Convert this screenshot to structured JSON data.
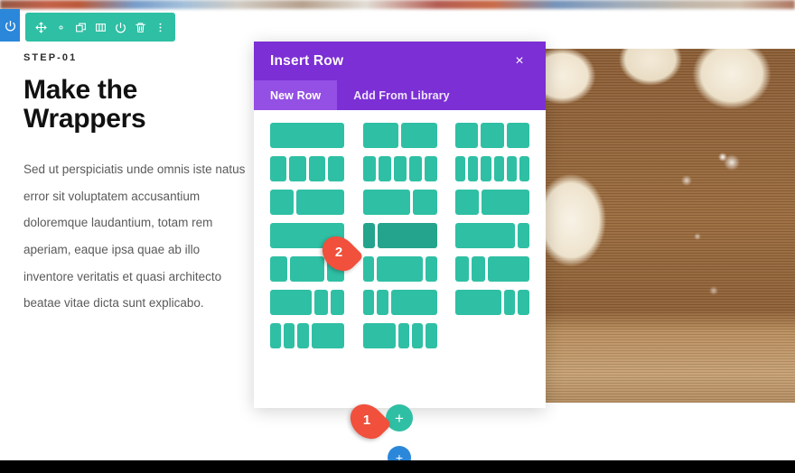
{
  "page": {
    "background_color": "#ffffff",
    "photo_strip_alt": "blurred photo band"
  },
  "element_toolbar": {
    "power_tab_icon": "power-icon",
    "buttons": [
      {
        "name": "move-handle",
        "icon": "move-arrows-icon",
        "title": "Move"
      },
      {
        "name": "settings-button",
        "icon": "gear-icon",
        "title": "Settings"
      },
      {
        "name": "duplicate-button",
        "icon": "duplicate-icon",
        "title": "Duplicate"
      },
      {
        "name": "columns-button",
        "icon": "columns-icon",
        "title": "Columns"
      },
      {
        "name": "disable-button",
        "icon": "power-icon",
        "title": "Disable"
      },
      {
        "name": "delete-button",
        "icon": "trash-icon",
        "title": "Delete"
      },
      {
        "name": "more-button",
        "icon": "ellipsis-vertical-icon",
        "title": "More Options"
      }
    ],
    "accent_color": "#2fbfa4",
    "power_tab_color": "#2b87da"
  },
  "content": {
    "eyebrow": "STEP-01",
    "headline": "Make the Wrappers",
    "paragraph": "Sed ut perspiciatis unde omnis iste natus error sit voluptatem accusantium doloremque laudantium, totam rem aperiam, eaque ipsa quae ab illo inventore veritatis et quasi architecto beatae vitae dicta sunt explicabo.",
    "image_alt": "Dough balls on a floured wooden cutting board"
  },
  "modal": {
    "title": "Insert Row",
    "close_label": "×",
    "header_color": "#7b2fd4",
    "active_tab_color": "#9450e4",
    "tabs": [
      {
        "label": "New Row",
        "active": true
      },
      {
        "label": "Add From Library",
        "active": false
      }
    ],
    "layout_color": "#2fbfa4",
    "layout_hover_color": "#24a48c",
    "layout_rows": [
      [
        {
          "name": "layout-1-1",
          "segments": [
            6
          ],
          "hover": false
        },
        {
          "name": "layout-1-2-1-2",
          "segments": [
            3,
            3
          ],
          "hover": false
        },
        {
          "name": "layout-1-3-1-3-1-3",
          "segments": [
            2,
            2,
            2
          ],
          "hover": false
        }
      ],
      [
        {
          "name": "layout-1-4-x4",
          "segments": [
            1,
            1,
            1,
            1
          ],
          "hover": false
        },
        {
          "name": "layout-1-5-x5",
          "segments": [
            1,
            1,
            1,
            1,
            1
          ],
          "hover": false
        },
        {
          "name": "layout-1-6-x6",
          "segments": [
            1,
            1,
            1,
            1,
            1,
            1
          ],
          "hover": false
        }
      ],
      [
        {
          "name": "layout-1-3-2-3",
          "segments": [
            2,
            4
          ],
          "hover": false
        },
        {
          "name": "layout-2-3-1-3",
          "segments": [
            4,
            2
          ],
          "hover": false
        },
        {
          "name": "layout-1-3-2-3-b",
          "segments": [
            2,
            4
          ],
          "hover": false
        }
      ],
      [
        {
          "name": "layout-1-1-b",
          "segments": [
            6
          ],
          "hover": false
        },
        {
          "name": "layout-1-5-4-5",
          "segments": [
            1,
            5
          ],
          "hover": true
        },
        {
          "name": "layout-4-5-1-5",
          "segments": [
            5,
            1
          ],
          "hover": false
        }
      ],
      [
        {
          "name": "layout-1-4-1-2-1-4",
          "segments": [
            1,
            2,
            1
          ],
          "hover": false
        },
        {
          "name": "layout-1-6-2-3-1-6",
          "segments": [
            1,
            4,
            1
          ],
          "hover": false
        },
        {
          "name": "layout-1-6-1-6-2-3",
          "segments": [
            1,
            1,
            3
          ],
          "hover": false
        }
      ],
      [
        {
          "name": "layout-1-2-1-4-1-4",
          "segments": [
            3,
            1,
            1
          ],
          "hover": false
        },
        {
          "name": "layout-1-6-1-6-2-3-b",
          "segments": [
            1,
            1,
            4
          ],
          "hover": false
        },
        {
          "name": "layout-2-3-1-6-1-6",
          "segments": [
            4,
            1,
            1
          ],
          "hover": false
        }
      ],
      [
        {
          "name": "layout-1-6-x3-1-2",
          "segments": [
            1,
            1,
            1,
            3
          ],
          "hover": false
        },
        {
          "name": "layout-1-2-1-6-x3",
          "segments": [
            3,
            1,
            1,
            1
          ],
          "hover": false
        },
        {
          "name": "layout-empty",
          "segments": [],
          "hover": false
        }
      ]
    ]
  },
  "add_buttons": {
    "teal_add_label": "+",
    "blue_add_label": "+",
    "teal_color": "#2fbfa4",
    "blue_color": "#2b87da"
  },
  "markers": [
    {
      "name": "annotation-marker-1",
      "label": "1",
      "color": "#f0503c"
    },
    {
      "name": "annotation-marker-2",
      "label": "2",
      "color": "#f0503c"
    }
  ]
}
